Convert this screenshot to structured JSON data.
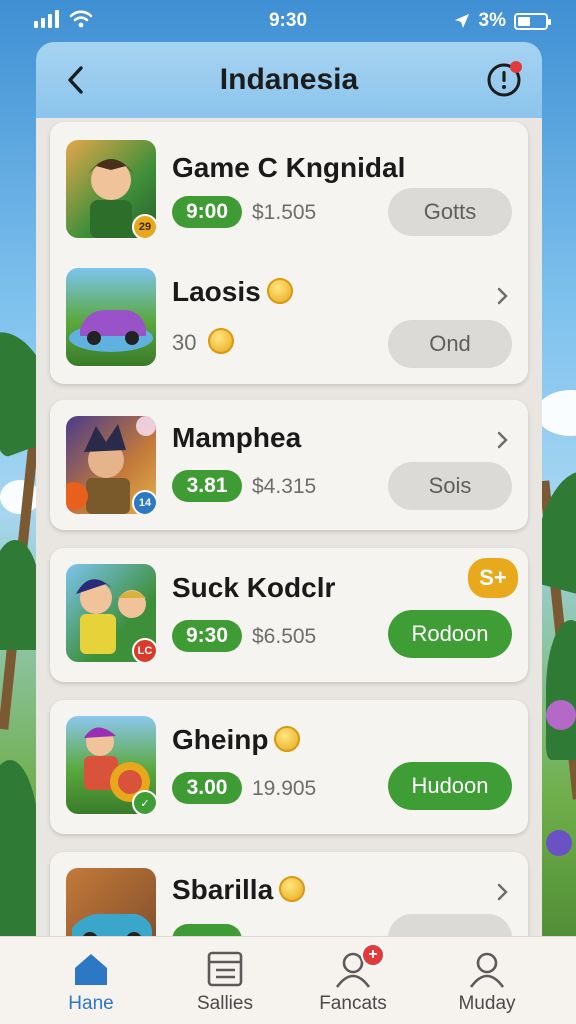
{
  "status_bar": {
    "time": "9:30",
    "battery": "3%",
    "icons": [
      "signal-icon",
      "wifi-icon",
      "location-icon",
      "battery-icon"
    ]
  },
  "header": {
    "title": "Indanesia",
    "back_icon": "chevron-left-icon",
    "alert_icon": "alert-icon"
  },
  "items": [
    {
      "name": "Game C Kngnidal",
      "pill": "9:00",
      "price": "$1.505",
      "action": "Gotts",
      "action_style": "gray"
    },
    {
      "name": "Laosis",
      "amount": "30",
      "action": "Ond",
      "action_style": "gray"
    },
    {
      "name": "Mamphea",
      "pill": "3.81",
      "price": "$4.315",
      "action": "Sois",
      "action_style": "gray"
    },
    {
      "name": "Suck Kodclr",
      "pill": "9:30",
      "price": "$6.505",
      "action": "Rodoon",
      "action_style": "green",
      "badge": "S+"
    },
    {
      "name": "Gheinp",
      "pill": "3.00",
      "price": "19.905",
      "action": "Hudoon",
      "action_style": "green"
    },
    {
      "name": "Sbarilla"
    }
  ],
  "thumb_badges": [
    "29",
    "14",
    "LC"
  ],
  "nav": [
    {
      "label": "Hane",
      "icon": "home-icon",
      "active": true
    },
    {
      "label": "Sallies",
      "icon": "list-icon"
    },
    {
      "label": "Fancats",
      "icon": "user-add-icon",
      "badge": "+"
    },
    {
      "label": "Muday",
      "icon": "profile-icon"
    }
  ],
  "colors": {
    "accent_green": "#3e9d35",
    "coin_gold": "#e8a81c",
    "active_blue": "#2c78c4",
    "header_blue": "#8cc4ec"
  }
}
